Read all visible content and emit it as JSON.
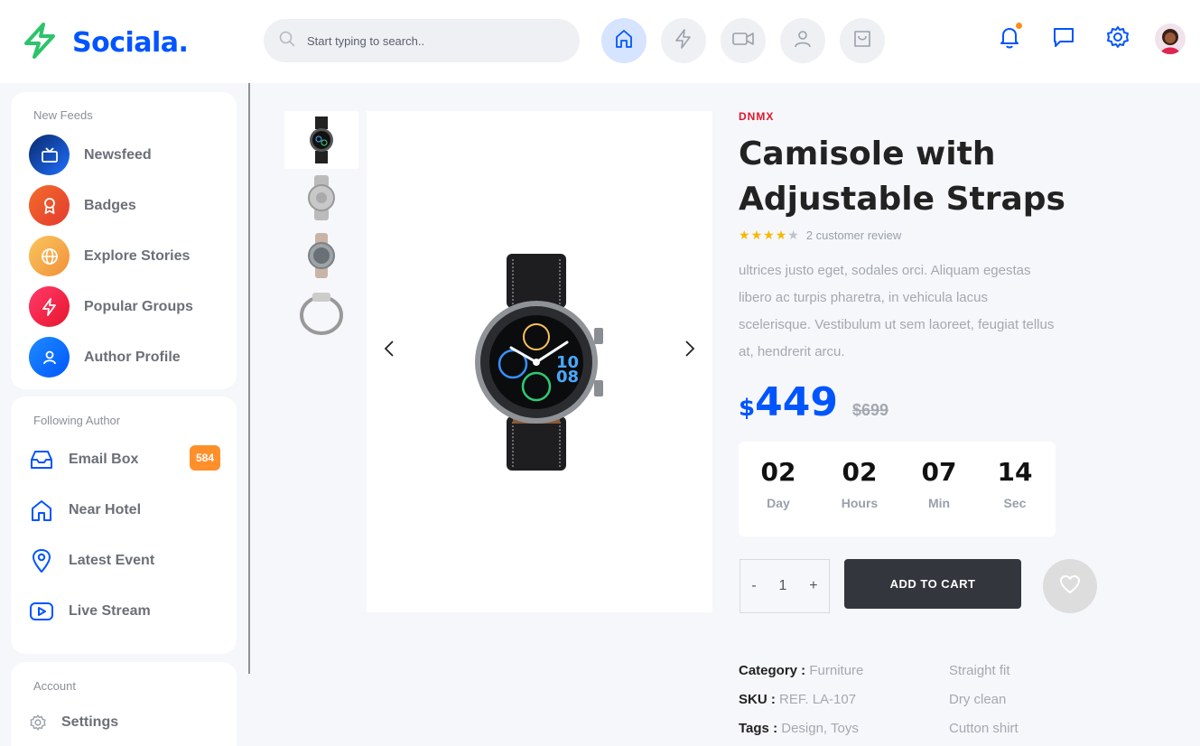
{
  "app": {
    "name": "Sociala."
  },
  "search": {
    "placeholder": "Start typing to search.."
  },
  "sidebar": {
    "new_feeds": {
      "title": "New Feeds",
      "items": [
        {
          "label": "Newsfeed"
        },
        {
          "label": "Badges"
        },
        {
          "label": "Explore Stories"
        },
        {
          "label": "Popular Groups"
        },
        {
          "label": "Author Profile"
        }
      ]
    },
    "following": {
      "title": "Following Author",
      "items": [
        {
          "label": "Email Box",
          "badge": "584"
        },
        {
          "label": "Near Hotel"
        },
        {
          "label": "Latest Event"
        },
        {
          "label": "Live Stream"
        }
      ]
    },
    "account": {
      "title": "Account",
      "items": [
        {
          "label": "Settings"
        }
      ]
    }
  },
  "product": {
    "brand": "DNMX",
    "title": "Camisole with Adjustable Straps",
    "rating": 4,
    "reviews": "2 customer review",
    "description": "ultrices justo eget, sodales orci. Aliquam egestas libero ac turpis pharetra, in vehicula lacus scelerisque. Vestibulum ut sem laoreet, feugiat tellus at, hendrerit arcu.",
    "currency": "$",
    "price": "449",
    "old_price": "$699",
    "countdown": [
      {
        "value": "02",
        "label": "Day"
      },
      {
        "value": "02",
        "label": "Hours"
      },
      {
        "value": "07",
        "label": "Min"
      },
      {
        "value": "14",
        "label": "Sec"
      }
    ],
    "quantity": {
      "minus": "-",
      "value": "1",
      "plus": "+"
    },
    "add_to_cart": "ADD TO CART",
    "meta": {
      "category_label": "Category :",
      "category": "Furniture",
      "sku_label": "SKU :",
      "sku": "REF. LA-107",
      "tags_label": "Tags :",
      "tags": "Design, Toys"
    },
    "features": [
      "Straight fit",
      "Dry clean",
      "Cutton shirt"
    ]
  },
  "colors": {
    "accent": "#0055ff",
    "brand_red": "#e0162b",
    "badge_orange": "#ff8f2b",
    "dark_button": "#33363d"
  }
}
